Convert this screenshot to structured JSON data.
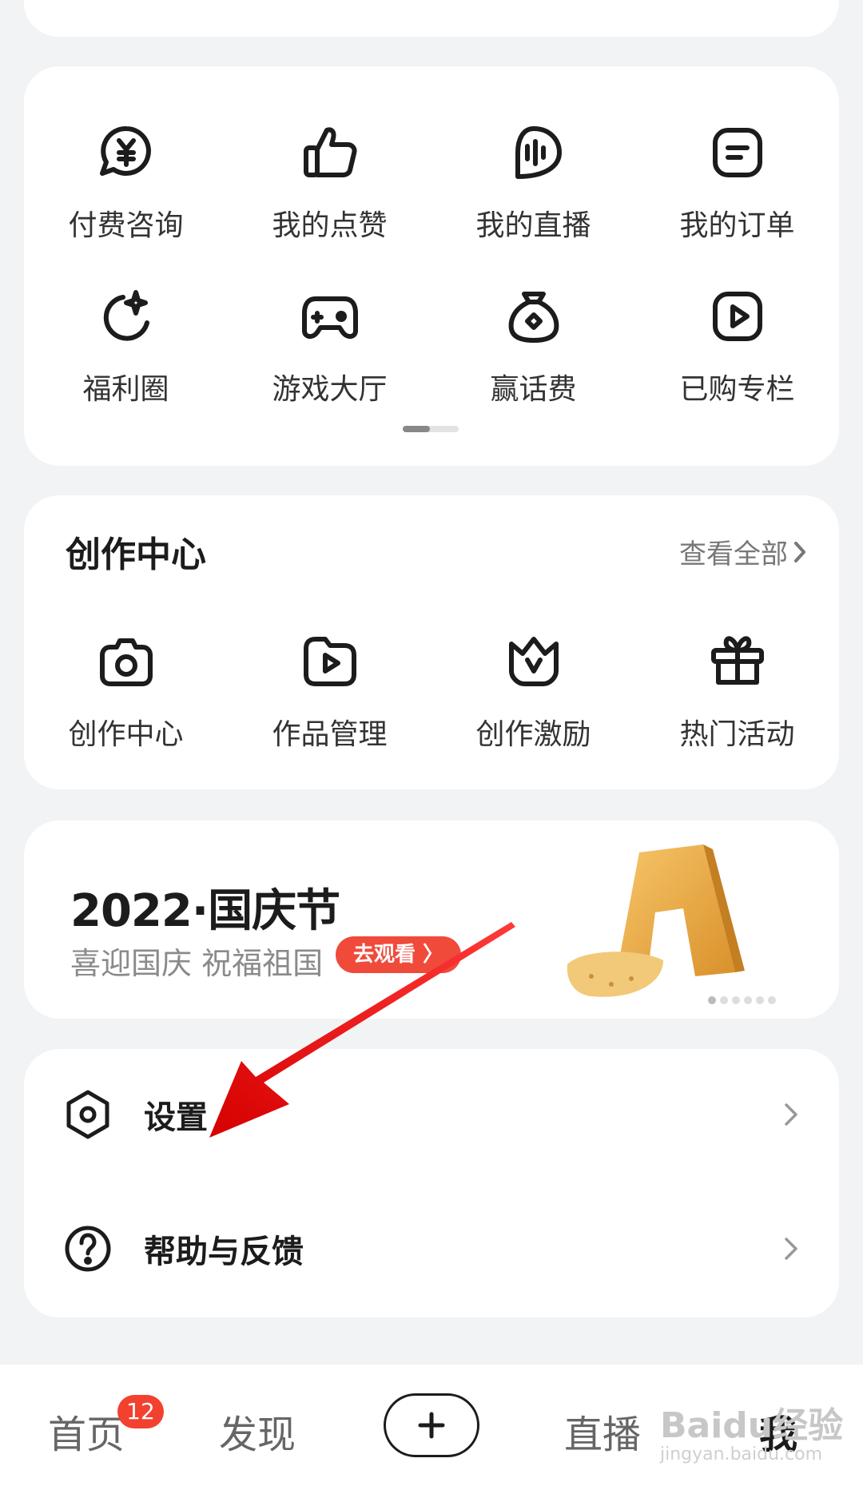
{
  "quick_grid": [
    {
      "label": "付费咨询",
      "icon": "yuan-chat-icon"
    },
    {
      "label": "我的点赞",
      "icon": "thumbs-up-icon"
    },
    {
      "label": "我的直播",
      "icon": "live-wave-icon"
    },
    {
      "label": "我的订单",
      "icon": "order-list-icon"
    },
    {
      "label": "福利圈",
      "icon": "moon-sparkle-icon"
    },
    {
      "label": "游戏大厅",
      "icon": "gamepad-icon"
    },
    {
      "label": "赢话费",
      "icon": "money-bag-icon"
    },
    {
      "label": "已购专栏",
      "icon": "play-square-icon"
    }
  ],
  "create_center": {
    "title": "创作中心",
    "view_all": "查看全部",
    "items": [
      {
        "label": "创作中心",
        "icon": "camera-icon"
      },
      {
        "label": "作品管理",
        "icon": "folder-play-icon"
      },
      {
        "label": "创作激励",
        "icon": "crown-v-icon"
      },
      {
        "label": "热门活动",
        "icon": "gift-icon"
      }
    ]
  },
  "banner": {
    "title": "2022·国庆节",
    "subtitle": "喜迎国庆 祝福祖国",
    "button": "去观看 〉",
    "accent": "#f04a3a"
  },
  "menu": {
    "settings": "设置",
    "help": "帮助与反馈"
  },
  "tabbar": {
    "home": "首页",
    "home_badge": "12",
    "discover": "发现",
    "live": "直播",
    "me": "我"
  },
  "watermark": {
    "brand": "Baidu经验",
    "url": "jingyan.baidu.com"
  }
}
